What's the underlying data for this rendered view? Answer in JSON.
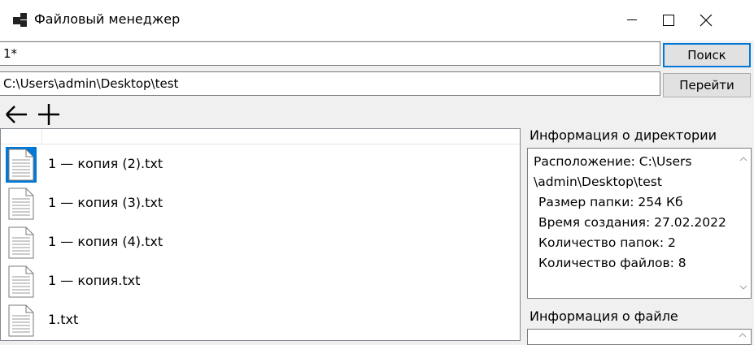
{
  "window": {
    "title": "Файловый менеджер"
  },
  "search": {
    "value": "1*",
    "button": "Поиск"
  },
  "path": {
    "value": "C:\\Users\\admin\\Desktop\\test",
    "button": "Перейти"
  },
  "toolbar": {
    "back_icon": "arrow-left-icon",
    "add_icon": "plus-icon"
  },
  "files": [
    {
      "name": "1 — копия (2).txt",
      "selected": true
    },
    {
      "name": "1 — копия (3).txt"
    },
    {
      "name": "1 — копия (4).txt"
    },
    {
      "name": "1 — копия.txt"
    },
    {
      "name": "1.txt"
    }
  ],
  "dir_info": {
    "label": "Информация о директории",
    "lines": [
      "Расположение: C:\\Users",
      "\\admin\\Desktop\\test",
      "Размер папки: 254 Кб",
      "Время создания: 27.02.2022",
      "Количество папок: 2",
      "Количество файлов: 8"
    ]
  },
  "file_info": {
    "label": "Информация о файле"
  },
  "colors": {
    "selection": "#0078d7",
    "window_bg": "#f0f0f0"
  }
}
